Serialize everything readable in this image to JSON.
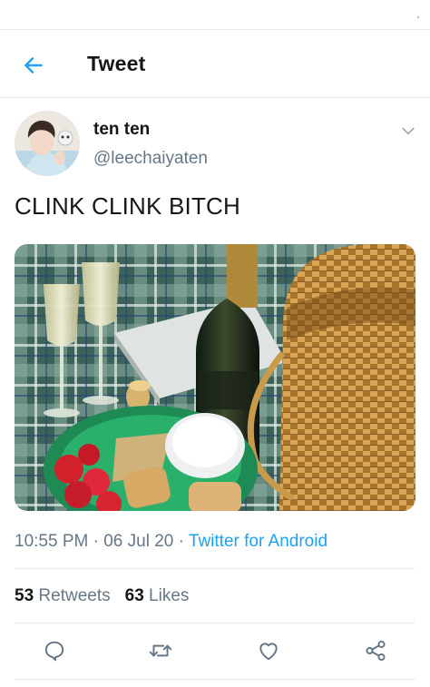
{
  "header": {
    "title": "Tweet"
  },
  "author": {
    "display_name": "ten ten",
    "handle": "@leechaiyaten"
  },
  "tweet": {
    "text": "CLINK CLINK BITCH",
    "time": "10:55 PM",
    "date": "06 Jul 20",
    "separator": "·",
    "source": "Twitter for Android"
  },
  "stats": {
    "retweets_count": "53",
    "retweets_label": "Retweets",
    "likes_count": "63",
    "likes_label": "Likes"
  },
  "icons": {
    "back": "arrow-left-icon",
    "more": "chevron-down-icon",
    "reply": "reply-icon",
    "retweet": "retweet-icon",
    "like": "heart-icon",
    "share": "share-icon"
  },
  "colors": {
    "accent": "#1da1f2",
    "secondary_text": "#657786",
    "divider": "#e6ecf0"
  }
}
